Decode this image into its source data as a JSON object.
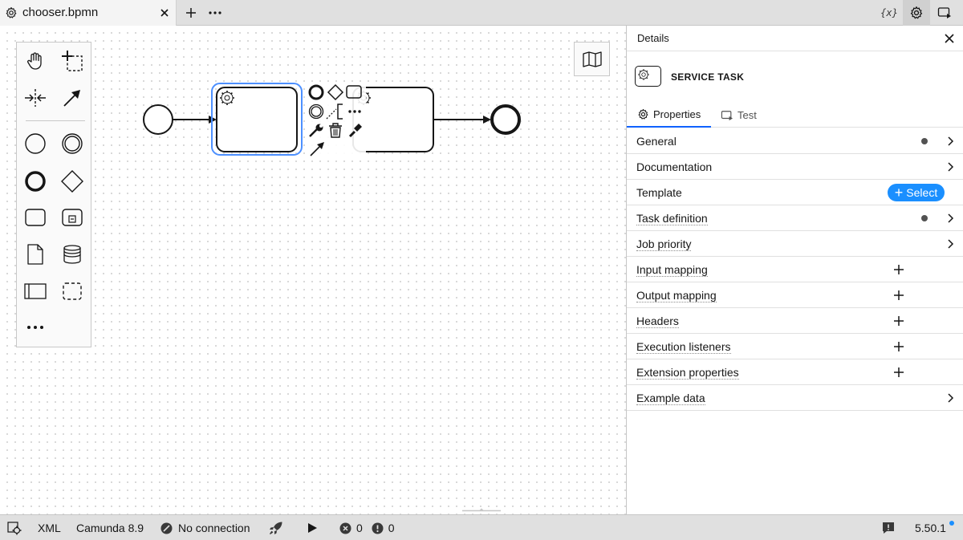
{
  "tab": {
    "filename": "chooser.bpmn"
  },
  "topbar": {
    "variables_icon_text": "{x}"
  },
  "details": {
    "title": "Details",
    "element_type": "SERVICE TASK",
    "tabs": [
      {
        "label": "Properties",
        "active": true
      },
      {
        "label": "Test",
        "active": false
      }
    ],
    "groups": [
      {
        "label": "General",
        "indicator": "dot",
        "action": "expand"
      },
      {
        "label": "Documentation",
        "indicator": "",
        "action": "expand"
      },
      {
        "label": "Template",
        "indicator": "",
        "action": "select",
        "button_label": "Select"
      },
      {
        "label": "Task definition",
        "indicator": "dot",
        "action": "expand"
      },
      {
        "label": "Job priority",
        "indicator": "",
        "action": "expand"
      },
      {
        "label": "Input mapping",
        "indicator": "",
        "action": "add"
      },
      {
        "label": "Output mapping",
        "indicator": "",
        "action": "add"
      },
      {
        "label": "Headers",
        "indicator": "",
        "action": "add"
      },
      {
        "label": "Execution listeners",
        "indicator": "",
        "action": "add"
      },
      {
        "label": "Extension properties",
        "indicator": "",
        "action": "add"
      },
      {
        "label": "Example data",
        "indicator": "",
        "action": "expand"
      }
    ]
  },
  "status": {
    "format": "XML",
    "engine": "Camunda 8.9",
    "connection": "No connection",
    "errors": "0",
    "warnings": "0",
    "version": "5.50.1"
  },
  "colors": {
    "accent": "#1a8fff",
    "selection": "#4d90ff",
    "tab_underline": "#0f62fe",
    "chrome_bg": "#e0e0e0"
  }
}
